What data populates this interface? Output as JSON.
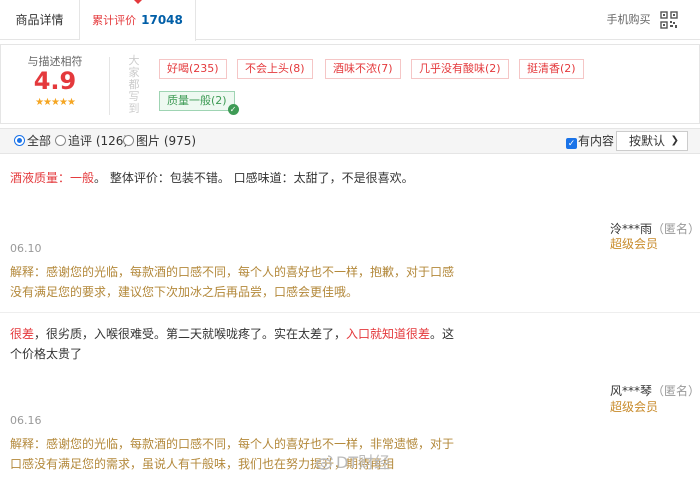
{
  "tabs": {
    "details": "商品详情",
    "reviews_label": "累计评价",
    "reviews_count": "17048",
    "mobile_buy": "手机购买"
  },
  "summary": {
    "rate_label": "与描述相符",
    "rate_score": "4.9",
    "stars": "★★★★★",
    "vertical_label": "大家都写到",
    "tags": [
      "好喝(235)",
      "不会上头(8)",
      "酒味不浓(7)",
      "几乎没有酸味(2)",
      "挺清香(2)",
      "质量一般(2)"
    ]
  },
  "filter": {
    "all": "全部",
    "append": "追评 (126)",
    "pictures": "图片 (975)",
    "has_content": "有内容",
    "sort": "按默认"
  },
  "reviews": [
    {
      "label": "酒液质量：一般",
      "text": "。 整体评价：包装不错。 口感味道：太甜了，不是很喜欢。",
      "user": "泠***雨",
      "anon": "（匿名）",
      "level": "超级会员",
      "date": "06.10",
      "reply": "解释：感谢您的光临，每款酒的口感不同，每个人的喜好也不一样，抱歉，对于口感没有满足您的要求，建议您下次加冰之后再品尝，口感会更佳哦。"
    },
    {
      "part1": "很差",
      "part2": "，很劣质，入喉很难受。第二天就喉咙疼了。实在太差了，",
      "part3": "入口就知道很差",
      "part4": "。这个价格太贵了",
      "user": "风***琴",
      "anon": "（匿名）",
      "level": "超级会员",
      "date": "06.16",
      "reply": "解释：感谢您的光临，每款酒的口感不同，每个人的喜好也不一样，非常遗憾，对于口感没有满足您的需求，虽说人有千般味，我们也在努力提升，期待再相"
    }
  ],
  "watermark": "DT财经",
  "colors": {
    "accent": "#e4393c",
    "link": "#005ea7",
    "reply": "#b3883a",
    "level": "#c88b2b",
    "tag_green": "#3e9b55"
  },
  "icons": [
    "qr-code-icon",
    "star-icon",
    "check-icon",
    "chevron-down-icon",
    "weibo-icon"
  ]
}
